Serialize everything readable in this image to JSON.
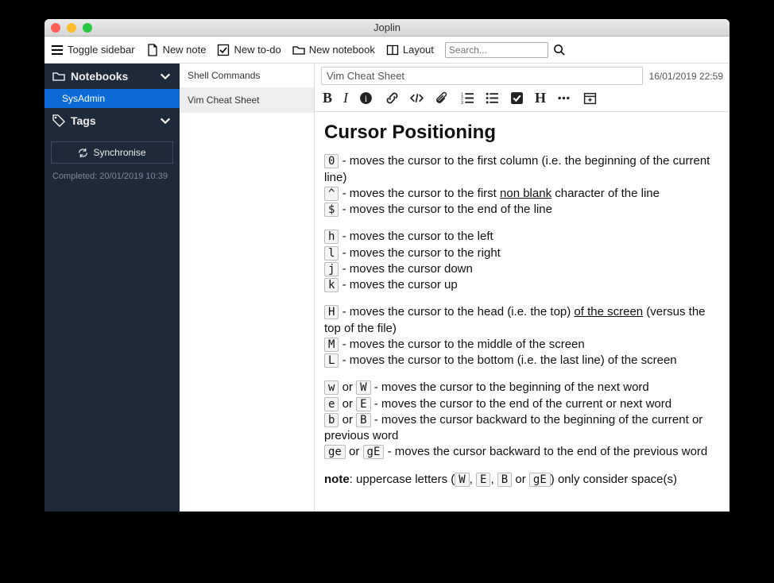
{
  "window": {
    "title": "Joplin"
  },
  "toolbar": {
    "toggle_sidebar": "Toggle sidebar",
    "new_note": "New note",
    "new_todo": "New to-do",
    "new_notebook": "New notebook",
    "layout": "Layout",
    "search_placeholder": "Search..."
  },
  "sidebar": {
    "notebooks_label": "Notebooks",
    "tags_label": "Tags",
    "notebooks": [
      {
        "label": "SysAdmin",
        "selected": true
      }
    ],
    "sync_button": "Synchronise",
    "sync_status": "Completed: 20/01/2019 10:39"
  },
  "notelist": {
    "items": [
      {
        "title": "Shell Commands",
        "selected": false
      },
      {
        "title": "Vim Cheat Sheet",
        "selected": true
      }
    ]
  },
  "editor": {
    "title": "Vim Cheat Sheet",
    "date": "16/01/2019 22:59",
    "heading": "Cursor Positioning",
    "lines": {
      "l0_key": "0",
      "l0_txt": " - moves the cursor to the first column (i.e. the beginning of the current line)",
      "l1_key": "^",
      "l1_pre": " - moves the cursor to the first ",
      "l1_u": "non blank",
      "l1_post": " character of the line",
      "l2_key": "$",
      "l2_txt": " - moves the cursor to the end of the line",
      "l3_key": "h",
      "l3_txt": " - moves the cursor to the left",
      "l4_key": "l",
      "l4_txt": " - moves the cursor to the right",
      "l5_key": "j",
      "l5_txt": " - moves the cursor down",
      "l6_key": "k",
      "l6_txt": " - moves the cursor up",
      "l7_key": "H",
      "l7_pre": " - moves the cursor to the head (i.e. the top) ",
      "l7_u": "of the screen",
      "l7_post": " (versus the top of the file)",
      "l8_key": "M",
      "l8_txt": " - moves the cursor to the middle of the screen",
      "l9_key": "L",
      "l9_txt": " - moves the cursor to the bottom (i.e. the last line) of the screen",
      "l10_k1": "w",
      "l10_or1": " or ",
      "l10_k2": "W",
      "l10_txt": " - moves the cursor to the beginning of the next word",
      "l11_k1": "e",
      "l11_or1": " or ",
      "l11_k2": "E",
      "l11_txt": " - moves the cursor to the end of the current or next word",
      "l12_k1": "b",
      "l12_or1": " or ",
      "l12_k2": "B",
      "l12_txt": " - moves the cursor backward to the beginning of the current or previous word",
      "l13_k1": "ge",
      "l13_or1": " or ",
      "l13_k2": "gE",
      "l13_txt": " - moves the cursor backward to the end of the previous word",
      "note_lead": "note",
      "note_pre": ": uppercase letters (",
      "note_k1": "W",
      "note_s1": ", ",
      "note_k2": "E",
      "note_s2": ", ",
      "note_k3": "B",
      "note_s3": " or ",
      "note_k4": "gE",
      "note_post": ") only consider space(s)"
    }
  }
}
